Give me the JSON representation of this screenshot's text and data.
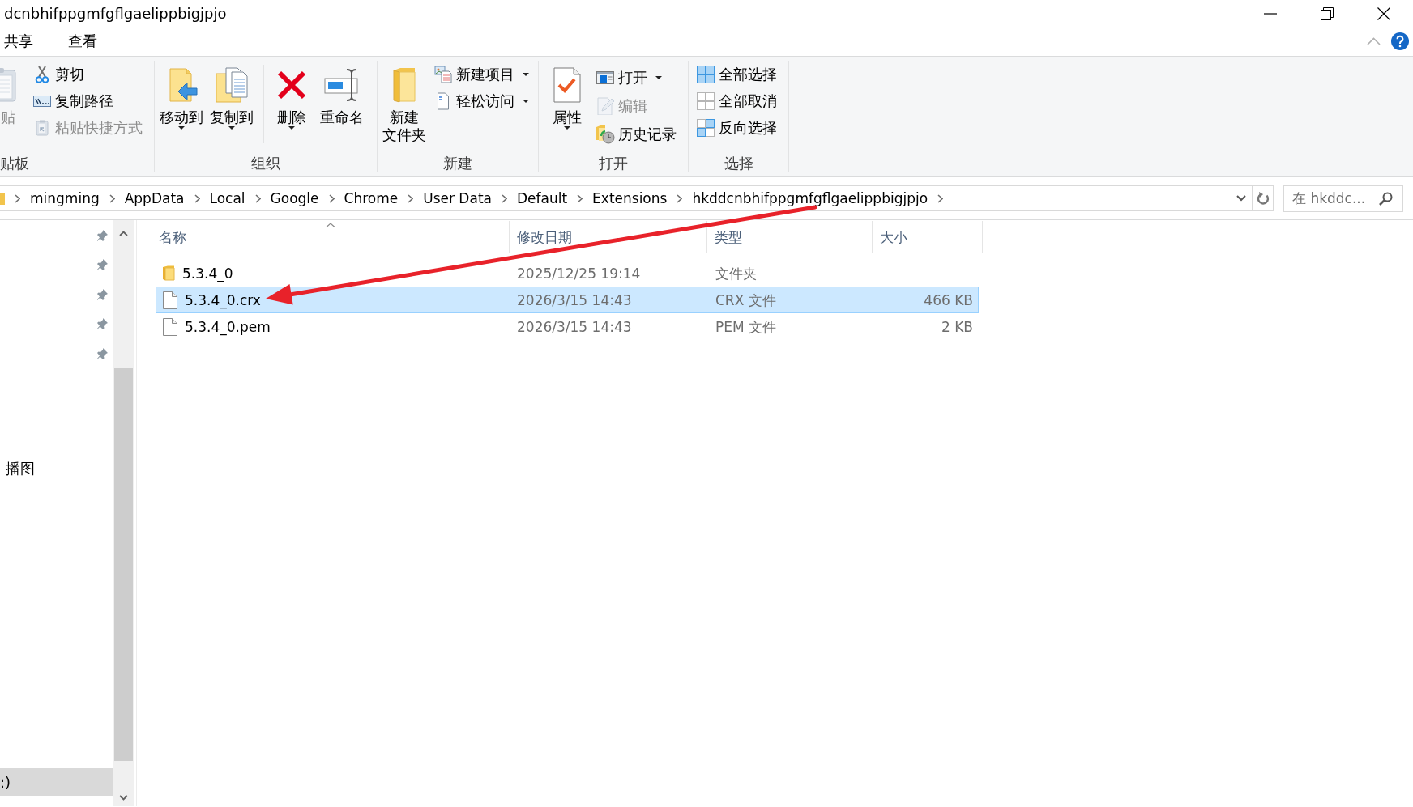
{
  "window": {
    "title": "dcnbhifppgmfgflgaelippbigjpjo"
  },
  "ribbon_tabs": [
    {
      "label": "共享",
      "selected": false
    },
    {
      "label": "查看",
      "selected": false
    }
  ],
  "ribbon": [
    {
      "label": "贴板",
      "items": [
        {
          "kind": "large",
          "label": "贴",
          "disabled": true,
          "dropdown": false
        },
        {
          "kind": "stack",
          "items": [
            {
              "label": "剪切",
              "disabled": false,
              "dropdown": false
            },
            {
              "label": "复制路径",
              "disabled": false,
              "dropdown": false
            },
            {
              "label": "粘贴快捷方式",
              "disabled": true,
              "dropdown": false
            }
          ]
        }
      ]
    },
    {
      "label": "组织",
      "items": [
        {
          "kind": "large",
          "label": "移动到",
          "disabled": false,
          "dropdown": true
        },
        {
          "kind": "large",
          "label": "复制到",
          "disabled": false,
          "dropdown": true
        },
        {
          "kind": "separator"
        },
        {
          "kind": "large",
          "label": "删除",
          "disabled": false,
          "dropdown": true
        },
        {
          "kind": "large",
          "label": "重命名",
          "disabled": false,
          "dropdown": false
        }
      ]
    },
    {
      "label": "新建",
      "items": [
        {
          "kind": "large",
          "lines": [
            "新建",
            "文件夹"
          ],
          "disabled": false,
          "dropdown": false
        },
        {
          "kind": "stack",
          "items": [
            {
              "label": "新建项目",
              "disabled": false,
              "dropdown": true
            },
            {
              "label": "轻松访问",
              "disabled": false,
              "dropdown": true
            }
          ]
        }
      ]
    },
    {
      "label": "打开",
      "items": [
        {
          "kind": "large",
          "label": "属性",
          "disabled": false,
          "dropdown": true
        },
        {
          "kind": "stack",
          "items": [
            {
              "label": "打开",
              "disabled": false,
              "dropdown": true
            },
            {
              "label": "编辑",
              "disabled": true,
              "dropdown": false
            },
            {
              "label": "历史记录",
              "disabled": false,
              "dropdown": false
            }
          ]
        }
      ]
    },
    {
      "label": "选择",
      "items": [
        {
          "kind": "stack",
          "items": [
            {
              "label": "全部选择",
              "disabled": false,
              "dropdown": false
            },
            {
              "label": "全部取消",
              "disabled": false,
              "dropdown": false
            },
            {
              "label": "反向选择",
              "disabled": false,
              "dropdown": false
            }
          ]
        }
      ]
    }
  ],
  "address_bar": {
    "path": [
      "mingming",
      "AppData",
      "Local",
      "Google",
      "Chrome",
      "User Data",
      "Default",
      "Extensions",
      "hkddcnbhifppgmfgflgaelippbigjpjo"
    ]
  },
  "search": {
    "placeholder": "在 hkddc..."
  },
  "nav_pane": {
    "sections": [
      {
        "items": [
          {
            "pinned": true,
            "selected": false
          },
          {
            "pinned": true,
            "selected": false
          },
          {
            "pinned": true,
            "selected": false
          },
          {
            "pinned": true,
            "selected": false
          },
          {
            "pinned": true,
            "selected": false
          }
        ]
      },
      {
        "items": [
          {
            "label": "播图",
            "pinned": false,
            "selected": false
          }
        ]
      },
      {
        "items": [
          {
            "label": ":)",
            "pinned": false,
            "selected": true
          }
        ]
      }
    ]
  },
  "file_list": {
    "columns": [
      {
        "label": "名称",
        "sorted": true
      },
      {
        "label": "修改日期",
        "sorted": false
      },
      {
        "label": "类型",
        "sorted": false
      },
      {
        "label": "大小",
        "sorted": false
      }
    ],
    "rows": [
      {
        "kind": "folder",
        "name": "5.3.4_0",
        "modified": "2025/12/25 19:14",
        "type": "文件夹",
        "selected": false
      },
      {
        "kind": "file",
        "name": "5.3.4_0.crx",
        "modified": "2026/3/15 14:43",
        "type": "CRX 文件",
        "size": "466 KB",
        "selected": true
      },
      {
        "kind": "file",
        "name": "5.3.4_0.pem",
        "modified": "2026/3/15 14:43",
        "type": "PEM 文件",
        "size": "2 KB",
        "selected": false
      }
    ]
  },
  "annotations": [
    {
      "kind": "arrow"
    }
  ]
}
